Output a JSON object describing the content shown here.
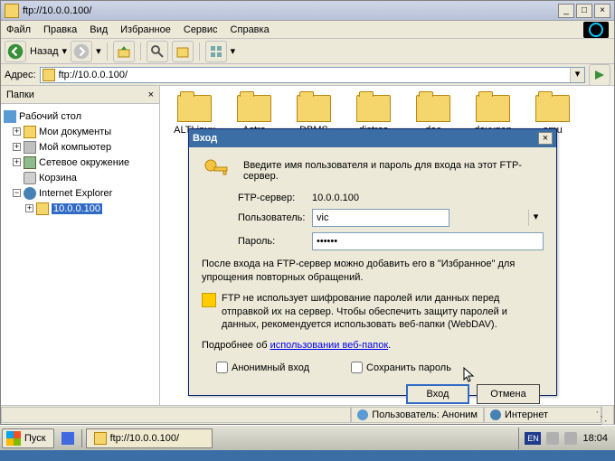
{
  "window": {
    "title": "ftp://10.0.0.100/",
    "min": "_",
    "max": "□",
    "close": "×"
  },
  "menu": {
    "file": "Файл",
    "edit": "Правка",
    "view": "Вид",
    "favorites": "Избранное",
    "tools": "Сервис",
    "help": "Справка"
  },
  "toolbar": {
    "back_label": "Назад",
    "back_dd": "▾",
    "fwd_dd": "▾",
    "views_dd": "▾"
  },
  "addressbar": {
    "label": "Адрес:",
    "value": "ftp://10.0.0.100/",
    "dd": "▾"
  },
  "sidebar": {
    "title": "Папки",
    "close": "×",
    "nodes": {
      "desktop": "Рабочий стол",
      "mydocs": "Мои документы",
      "mycomputer": "Мой компьютер",
      "network": "Сетевое окружение",
      "trash": "Корзина",
      "ie": "Internet Explorer",
      "ftp": "10.0.0.100"
    }
  },
  "folders": [
    {
      "name": "ALTLinux"
    },
    {
      "name": "Astra"
    },
    {
      "name": "DBMS"
    },
    {
      "name": "distros"
    },
    {
      "name": "doc"
    },
    {
      "name": "doxygen"
    },
    {
      "name": "emu"
    }
  ],
  "dialog": {
    "title": "Вход",
    "intro": "Введите имя пользователя и пароль для входа на этот FTP-сервер.",
    "server_label": "FTP-сервер:",
    "server_value": "10.0.0.100",
    "user_label": "Пользователь:",
    "user_value": "vic",
    "pass_label": "Пароль:",
    "pass_value": "••••••",
    "note1": "После входа на FTP-сервер можно добавить его в \"Избранное\" для упрощения повторных обращений.",
    "note2": "FTP не использует шифрование паролей или данных перед отправкой их на сервер. Чтобы обеспечить защиту паролей и данных, рекомендуется использовать веб-папки (WebDAV).",
    "note3a": "Подробнее об ",
    "note3_link": "использовании веб-папок",
    "note3b": ".",
    "anon": "Анонимный вход",
    "savepw": "Сохранить пароль",
    "login": "Вход",
    "cancel": "Отмена",
    "close": "×"
  },
  "statusbar": {
    "user_label": "Пользователь: Аноним",
    "zone": "Интернет"
  },
  "taskbar": {
    "start": "Пуск",
    "task1": "ftp://10.0.0.100/",
    "lang": "EN",
    "clock": "18:04"
  }
}
